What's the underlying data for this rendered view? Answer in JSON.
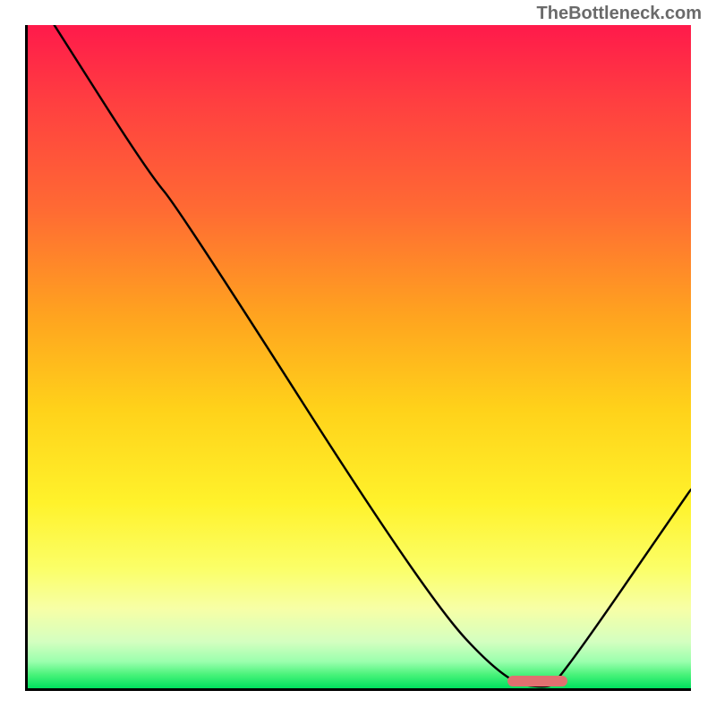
{
  "watermark": "TheBottleneck.com",
  "chart_data": {
    "type": "line",
    "title": "",
    "xlabel": "",
    "ylabel": "",
    "xlim": [
      0,
      100
    ],
    "ylim": [
      0,
      100
    ],
    "grid": false,
    "legend": false,
    "series": [
      {
        "name": "bottleneck-curve",
        "x": [
          4,
          18,
          23,
          60,
          72,
          78,
          80,
          100
        ],
        "values": [
          100,
          78,
          72,
          14,
          1,
          0,
          1,
          30
        ]
      }
    ],
    "marker": {
      "x_start": 72,
      "x_end": 81,
      "y": 0
    },
    "gradient_stops": [
      {
        "pct": 0,
        "color": "#ff1a4b"
      },
      {
        "pct": 12,
        "color": "#ff4040"
      },
      {
        "pct": 28,
        "color": "#ff6b33"
      },
      {
        "pct": 44,
        "color": "#ffa41f"
      },
      {
        "pct": 58,
        "color": "#ffd21a"
      },
      {
        "pct": 72,
        "color": "#fff22b"
      },
      {
        "pct": 82,
        "color": "#fbff68"
      },
      {
        "pct": 88,
        "color": "#f7ffa6"
      },
      {
        "pct": 93,
        "color": "#d4ffc0"
      },
      {
        "pct": 96,
        "color": "#9affad"
      },
      {
        "pct": 98,
        "color": "#47f279"
      },
      {
        "pct": 100,
        "color": "#00e05e"
      }
    ]
  }
}
